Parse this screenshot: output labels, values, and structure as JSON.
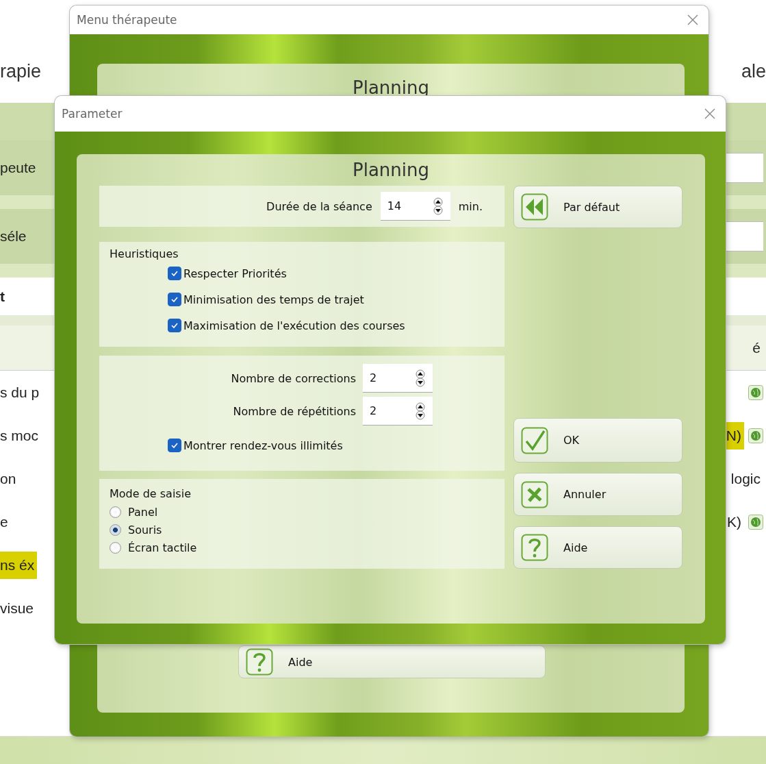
{
  "background": {
    "title_left": "rapie",
    "title_right": "ale",
    "rows": [
      {
        "kind": "green",
        "left": {
          "text": "peute",
          "highlighted": false
        },
        "right": [
          {
            "kind": "field"
          }
        ]
      },
      {
        "kind": "green",
        "left": {
          "text": "séle",
          "highlighted": false
        },
        "right": [
          {
            "kind": "field"
          }
        ]
      },
      {
        "kind": "bold",
        "left": {
          "text": "t",
          "highlighted": false
        }
      },
      {
        "kind": "header",
        "right": [
          {
            "kind": "text",
            "text": "é",
            "highlighted": false
          }
        ]
      },
      {
        "kind": "item",
        "left": {
          "text": "s du p",
          "highlighted": false
        },
        "right": [
          {
            "kind": "globe"
          }
        ]
      },
      {
        "kind": "item",
        "left": {
          "text": "s moc",
          "highlighted": false
        },
        "right": [
          {
            "kind": "text",
            "text": "N)",
            "highlighted": true
          },
          {
            "kind": "globe"
          }
        ]
      },
      {
        "kind": "item",
        "left": {
          "text": "on",
          "highlighted": false
        },
        "right": [
          {
            "kind": "text",
            "text": "logic",
            "highlighted": false
          }
        ]
      },
      {
        "kind": "item",
        "left": {
          "text": "e",
          "highlighted": false
        },
        "right": [
          {
            "kind": "text",
            "text": "K)",
            "highlighted": false
          },
          {
            "kind": "globe"
          }
        ]
      },
      {
        "kind": "item",
        "left": {
          "text": "ns éx",
          "highlighted": true
        }
      },
      {
        "kind": "item",
        "left": {
          "text": "visue",
          "highlighted": false
        }
      }
    ]
  },
  "menu_dialog": {
    "title": "Menu thérapeute",
    "heading": "Planning",
    "help_button": {
      "kind": "help",
      "label": "Aide"
    }
  },
  "parameter_dialog": {
    "title": "Parameter",
    "heading": "Planning",
    "duration": {
      "label": "Durée de la séance",
      "value": "14",
      "unit": "min."
    },
    "heuristics": {
      "title": "Heuristiques",
      "options": [
        {
          "label": "Respecter Priorités",
          "checked": true
        },
        {
          "label": "Minimisation des temps de trajet",
          "checked": true
        },
        {
          "label": "Maximisation de l'exécution des courses",
          "checked": true
        }
      ]
    },
    "counts": [
      {
        "label": "Nombre de corrections",
        "value": "2"
      },
      {
        "label": "Nombre de répétitions",
        "value": "2"
      }
    ],
    "unlimited": {
      "label": "Montrer rendez-vous illimités",
      "checked": true
    },
    "input_mode": {
      "title": "Mode de saisie",
      "options": [
        {
          "label": "Panel",
          "selected": false
        },
        {
          "label": "Souris",
          "selected": true
        },
        {
          "label": "Écran tactile",
          "selected": false
        }
      ]
    },
    "buttons": [
      {
        "kind": "default",
        "label": "Par défaut"
      },
      {
        "kind": "ok",
        "label": "OK"
      },
      {
        "kind": "cancel",
        "label": "Annuler"
      },
      {
        "kind": "help",
        "label": "Aide"
      }
    ]
  }
}
